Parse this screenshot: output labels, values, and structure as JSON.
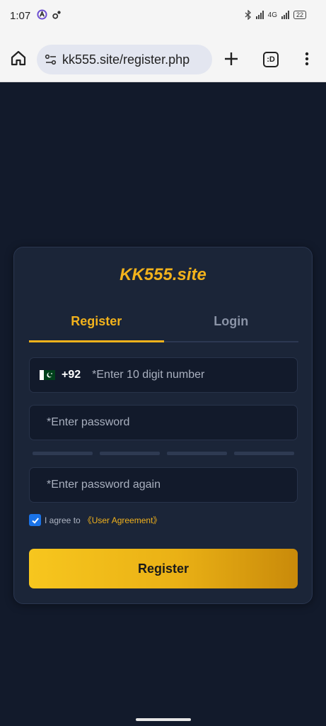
{
  "status_bar": {
    "time": "1:07",
    "network_label": "4G",
    "battery": "22"
  },
  "browser": {
    "url": "kk555.site/register.php",
    "tab_count_label": ":D"
  },
  "card": {
    "brand": "KK555.site",
    "tabs": [
      {
        "label": "Register",
        "active": true
      },
      {
        "label": "Login",
        "active": false
      }
    ],
    "phone": {
      "country_code": "+92",
      "placeholder": "*Enter 10 digit number",
      "value": ""
    },
    "password": {
      "placeholder": "*Enter password",
      "value": ""
    },
    "password_again": {
      "placeholder": "*Enter password again",
      "value": ""
    },
    "agree": {
      "checked": true,
      "text": "I agree to",
      "link": "《User Agreement》"
    },
    "submit_label": "Register"
  },
  "colors": {
    "accent": "#f2b21c",
    "background": "#121a2b",
    "card": "#1b2538"
  }
}
